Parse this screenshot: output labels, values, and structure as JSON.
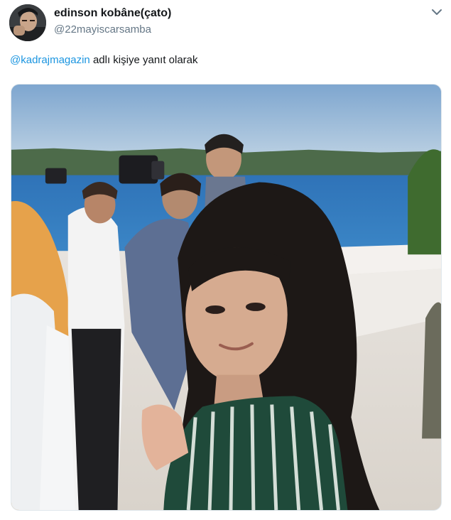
{
  "tweet": {
    "author": {
      "display_name": "edinson kobâne(çato)",
      "handle": "@22mayiscarsamba",
      "avatar_icon": "profile-avatar"
    },
    "menu_icon": "chevron-down-icon",
    "reply_context": {
      "mention": "@kadrajmagazin",
      "suffix": " adlı kişiye yanıt olarak"
    },
    "media": {
      "type": "video-still"
    }
  },
  "colors": {
    "link": "#1b95e0",
    "secondary_text": "#657786",
    "primary_text": "#14171a",
    "border": "#e1e8ed"
  }
}
